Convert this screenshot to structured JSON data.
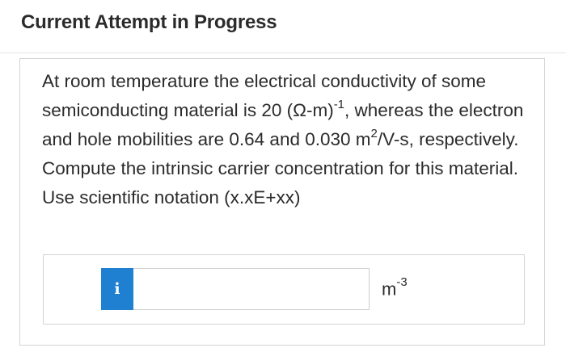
{
  "header": {
    "title": "Current Attempt in Progress"
  },
  "question": {
    "part1": "At room temperature the electrical conductivity of some semiconducting material is 20 (Ω-m)",
    "sup1": "-1",
    "part2": ", whereas the electron and hole mobilities are 0.64 and 0.030 m",
    "sup2": "2",
    "part3": "/V-s, respectively. Compute the intrinsic carrier concentration for this material. Use scientific notation (x.xE+xx)"
  },
  "answer": {
    "info_label": "i",
    "input_value": "",
    "units_base": "m",
    "units_exponent": "-3"
  },
  "colors": {
    "info_button": "#1f7fd0",
    "text": "#2b2b2b",
    "border": "#d4d4d4"
  }
}
